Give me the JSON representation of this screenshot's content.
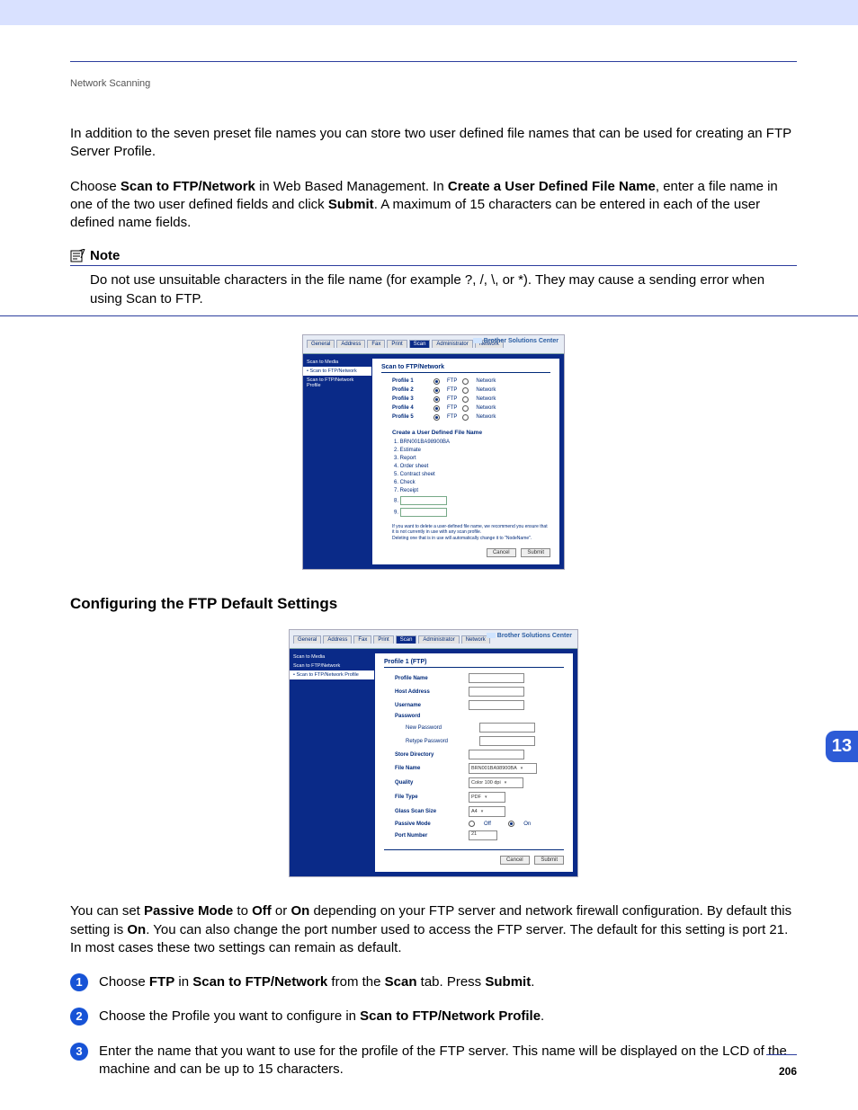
{
  "header": {
    "section": "Network Scanning"
  },
  "intro_1": "In addition to the seven preset file names you can store two user defined file names that can be used for creating an FTP Server Profile.",
  "intro_2_parts": {
    "a": "Choose ",
    "b": "Scan to FTP/Network",
    "c": " in Web Based Management. In ",
    "d": "Create a User Defined File Name",
    "e": ", enter a file name in one of the two user defined fields and click ",
    "f": "Submit",
    "g": ". A maximum of 15 characters can be entered in each of the user defined name fields."
  },
  "note": {
    "label": "Note",
    "body": "Do not use unsuitable characters in the file name (for example ?, /, \\, or *). They may cause a sending error when using Scan to FTP."
  },
  "shot1": {
    "brand": "Brother Solutions Center",
    "tabs": [
      "General",
      "Address",
      "Fax",
      "Print",
      "Scan",
      "Administrator",
      "Network"
    ],
    "active_tab": 4,
    "sidebar": [
      "Scan to Media",
      "• Scan to FTP/Network",
      "Scan to FTP/Network Profile"
    ],
    "sidebar_sel": 1,
    "title": "Scan to FTP/Network",
    "profiles": [
      "Profile 1",
      "Profile 2",
      "Profile 3",
      "Profile 4",
      "Profile 5"
    ],
    "radio_labels": {
      "ftp": "FTP",
      "network": "Network"
    },
    "subtitle": "Create a User Defined File Name",
    "filenames": [
      "BRN001BA98900BA",
      "Estimate",
      "Report",
      "Order sheet",
      "Contract sheet",
      "Check",
      "Receipt"
    ],
    "fineprint1": "If you want to delete a user-defined file name, we recommend you ensure that it is not currently in use with any scan profile.",
    "fineprint2": "Deleting one that is in use will automatically change it to \"NodeName\".",
    "buttons": {
      "cancel": "Cancel",
      "submit": "Submit"
    }
  },
  "heading2": "Configuring the FTP Default Settings",
  "shot2": {
    "brand": "Brother Solutions Center",
    "tabs": [
      "General",
      "Address",
      "Fax",
      "Print",
      "Scan",
      "Administrator",
      "Network"
    ],
    "active_tab": 4,
    "sidebar": [
      "Scan to Media",
      "Scan to FTP/Network",
      "• Scan to FTP/Network Profile"
    ],
    "sidebar_sel": 2,
    "title": "Profile 1 (FTP)",
    "fields": [
      {
        "label": "Profile Name",
        "type": "input",
        "value": ""
      },
      {
        "label": "Host Address",
        "type": "input",
        "value": ""
      },
      {
        "label": "Username",
        "type": "input",
        "value": ""
      },
      {
        "label": "Password",
        "type": "label_only"
      },
      {
        "label": "New Password",
        "type": "input",
        "value": "",
        "indent": true
      },
      {
        "label": "Retype Password",
        "type": "input",
        "value": "",
        "indent": true
      },
      {
        "label": "Store Directory",
        "type": "input",
        "value": ""
      },
      {
        "label": "File Name",
        "type": "select",
        "value": "BRN001BA98900BA"
      },
      {
        "label": "Quality",
        "type": "select",
        "value": "Color 100 dpi"
      },
      {
        "label": "File Type",
        "type": "select",
        "value": "PDF"
      },
      {
        "label": "Glass Scan Size",
        "type": "select",
        "value": "A4"
      },
      {
        "label": "Passive Mode",
        "type": "radio_onoff",
        "off": "Off",
        "on": "On",
        "selected": "On"
      },
      {
        "label": "Port Number",
        "type": "input",
        "value": "21"
      }
    ],
    "buttons": {
      "cancel": "Cancel",
      "submit": "Submit"
    }
  },
  "passive_parts": {
    "a": "You can set ",
    "b": "Passive Mode",
    "c": " to ",
    "d": "Off",
    "e": " or ",
    "f": "On",
    "g": " depending on your FTP server and network firewall configuration. By default this setting is ",
    "h": "On",
    "i": ". You can also change the port number used to access the FTP server. The default for this setting is port 21. In most cases these two settings can remain as default."
  },
  "steps": [
    {
      "a": "Choose ",
      "b": "FTP",
      "c": " in ",
      "d": "Scan to FTP/Network",
      "e": " from the ",
      "f": "Scan",
      "g": " tab. Press ",
      "h": "Submit",
      "i": "."
    },
    {
      "a": "Choose the Profile you want to configure in ",
      "b": "Scan to FTP/Network Profile",
      "c": "."
    },
    {
      "a": "Enter the name that you want to use for the profile of the FTP server. This name will be displayed on the LCD of the machine and can be up to 15 characters."
    }
  ],
  "chapter": "13",
  "page_number": "206"
}
